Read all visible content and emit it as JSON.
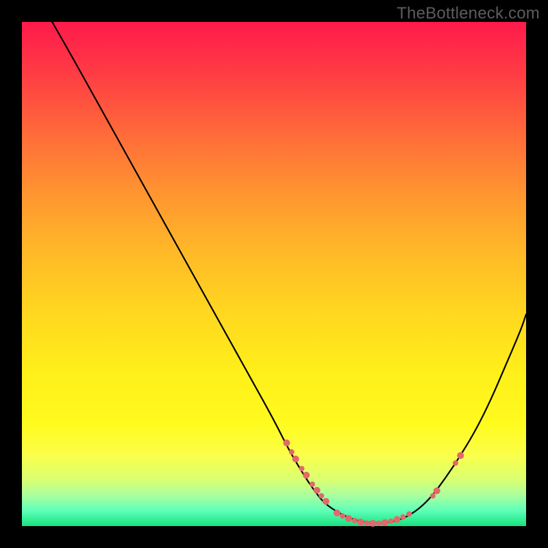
{
  "watermark": "TheBottleneck.com",
  "colors": {
    "background": "#000000",
    "curve": "#000000",
    "marker": "#e06a6a"
  },
  "chart_data": {
    "type": "line",
    "title": "",
    "xlabel": "",
    "ylabel": "",
    "xlim": [
      0,
      100
    ],
    "ylim": [
      0,
      100
    ],
    "grid": false,
    "legend": false,
    "curve_points": [
      {
        "x": 6,
        "y": 100
      },
      {
        "x": 10,
        "y": 93
      },
      {
        "x": 15,
        "y": 84
      },
      {
        "x": 20,
        "y": 75
      },
      {
        "x": 25,
        "y": 66
      },
      {
        "x": 30,
        "y": 57
      },
      {
        "x": 35,
        "y": 48
      },
      {
        "x": 40,
        "y": 39
      },
      {
        "x": 45,
        "y": 30
      },
      {
        "x": 50,
        "y": 21
      },
      {
        "x": 53,
        "y": 15
      },
      {
        "x": 56,
        "y": 10
      },
      {
        "x": 58,
        "y": 7
      },
      {
        "x": 60,
        "y": 4.5
      },
      {
        "x": 63,
        "y": 2.5
      },
      {
        "x": 66,
        "y": 1.2
      },
      {
        "x": 69,
        "y": 0.6
      },
      {
        "x": 72,
        "y": 0.6
      },
      {
        "x": 75,
        "y": 1.2
      },
      {
        "x": 78,
        "y": 2.8
      },
      {
        "x": 81,
        "y": 5.5
      },
      {
        "x": 84,
        "y": 9.5
      },
      {
        "x": 87,
        "y": 14
      },
      {
        "x": 90,
        "y": 19
      },
      {
        "x": 93,
        "y": 25
      },
      {
        "x": 96,
        "y": 32
      },
      {
        "x": 99,
        "y": 39
      },
      {
        "x": 100,
        "y": 42
      }
    ],
    "marker_clusters": [
      {
        "x": 52.5,
        "y": 16.5,
        "r": 5
      },
      {
        "x": 53.5,
        "y": 14.7,
        "r": 4
      },
      {
        "x": 54.3,
        "y": 13.3,
        "r": 5
      },
      {
        "x": 55.5,
        "y": 11.4,
        "r": 4
      },
      {
        "x": 56.4,
        "y": 10.1,
        "r": 5
      },
      {
        "x": 57.6,
        "y": 8.3,
        "r": 4
      },
      {
        "x": 58.5,
        "y": 7.1,
        "r": 5
      },
      {
        "x": 59.4,
        "y": 6.0,
        "r": 4
      },
      {
        "x": 60.3,
        "y": 4.9,
        "r": 5
      },
      {
        "x": 62.5,
        "y": 2.6,
        "r": 5
      },
      {
        "x": 63.6,
        "y": 2.0,
        "r": 4
      },
      {
        "x": 64.8,
        "y": 1.5,
        "r": 5
      },
      {
        "x": 66.0,
        "y": 1.1,
        "r": 4
      },
      {
        "x": 67.2,
        "y": 0.8,
        "r": 5
      },
      {
        "x": 68.4,
        "y": 0.6,
        "r": 4
      },
      {
        "x": 69.6,
        "y": 0.55,
        "r": 5
      },
      {
        "x": 70.8,
        "y": 0.55,
        "r": 4
      },
      {
        "x": 72.0,
        "y": 0.7,
        "r": 5
      },
      {
        "x": 73.2,
        "y": 0.95,
        "r": 4
      },
      {
        "x": 74.4,
        "y": 1.3,
        "r": 5
      },
      {
        "x": 75.6,
        "y": 1.8,
        "r": 4
      },
      {
        "x": 76.8,
        "y": 2.4,
        "r": 4
      },
      {
        "x": 81.5,
        "y": 6.0,
        "r": 4
      },
      {
        "x": 82.3,
        "y": 7.0,
        "r": 5
      },
      {
        "x": 86.0,
        "y": 12.5,
        "r": 4
      },
      {
        "x": 87.0,
        "y": 14.0,
        "r": 5
      }
    ]
  }
}
